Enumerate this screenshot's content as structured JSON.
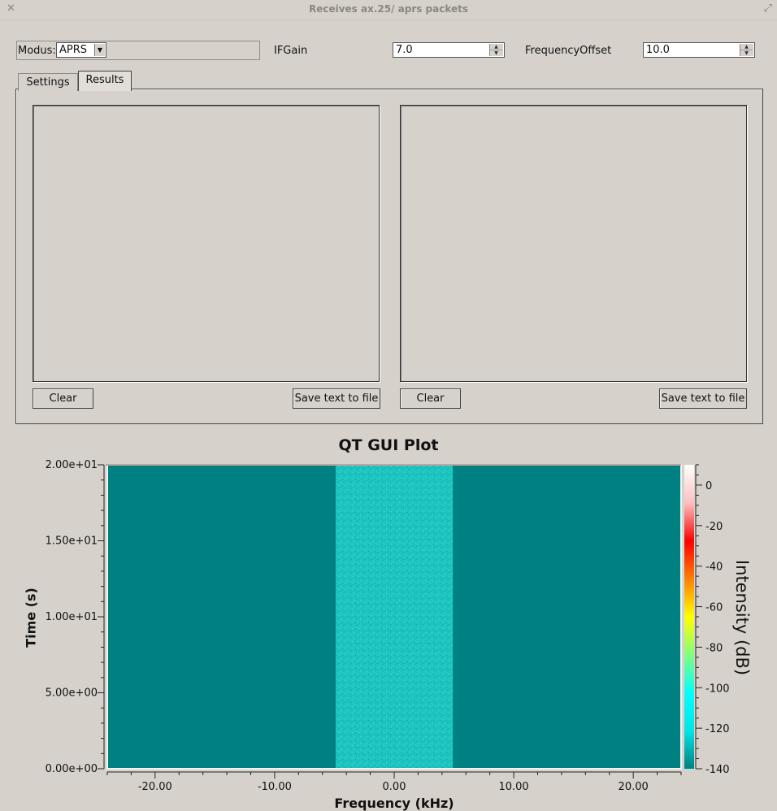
{
  "window": {
    "title": "Receives ax.25/ aprs packets",
    "close_icon": "close-icon",
    "maximize_icon": "maximize-icon"
  },
  "controls": {
    "modus_label": "Modus:",
    "modus_value": "APRS",
    "ifgain_label": "IFGain",
    "ifgain_value": "7.0",
    "freq_offset_label": "FrequencyOffset",
    "freq_offset_value": "10.0"
  },
  "tabs": [
    {
      "label": "Settings",
      "active": false
    },
    {
      "label": "Results",
      "active": true
    }
  ],
  "results": {
    "left": {
      "clear_label": "Clear",
      "save_label": "Save text to file"
    },
    "right": {
      "clear_label": "Clear",
      "save_label": "Save text to file"
    }
  },
  "chart_data": {
    "type": "heatmap",
    "title": "QT GUI Plot",
    "xlabel": "Frequency (kHz)",
    "ylabel": "Time (s)",
    "colorbar_label": "Intensity (dB)",
    "xlim": [
      -24,
      24
    ],
    "ylim": [
      0,
      20
    ],
    "x_ticks": [
      -20,
      -10,
      0,
      10,
      20
    ],
    "x_tick_labels": [
      "-20.00",
      "-10.00",
      "0.00",
      "10.00",
      "20.00"
    ],
    "y_ticks": [
      0,
      5,
      10,
      15,
      20
    ],
    "y_tick_labels": [
      "0.00e+00",
      "5.00e+00",
      "1.00e+01",
      "1.50e+01",
      "2.00e+01"
    ],
    "colorbar_ticks": [
      0,
      -20,
      -40,
      -60,
      -80,
      -100,
      -120,
      -140
    ],
    "colorbar_range": [
      -140,
      10
    ],
    "background_color": "#008080",
    "passband": {
      "x_start": -4.9,
      "x_end": 4.9,
      "color": "#1fc6c2"
    },
    "colormap": [
      "#008080",
      "#00e5e5",
      "#00ffff",
      "#7fff7f",
      "#ffff00",
      "#ff8000",
      "#ff0000",
      "#ffbfbf",
      "#ffffff"
    ]
  }
}
